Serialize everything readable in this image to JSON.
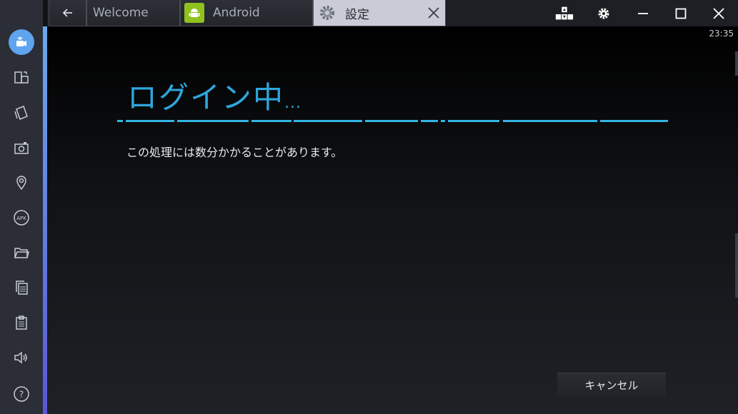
{
  "tabs": {
    "welcome": "Welcome",
    "android": "Android",
    "settings": "設定"
  },
  "status": {
    "clock": "23:35"
  },
  "dialog": {
    "title": "ログイン中",
    "title_suffix": "...",
    "message": "この処理には数分かかることがあります。",
    "cancel_label": "キャンセル"
  },
  "sidebar": {
    "apk_label": "APK",
    "help_label": "?"
  },
  "colors": {
    "accent": "#2ea6dc",
    "active_sidebar": "#5ea4ee",
    "android_green": "#8fc21f"
  },
  "icons": {
    "sidebar": [
      "video-call-icon",
      "phone-rotate-icon",
      "shake-icon",
      "screenshot-icon",
      "location-icon",
      "apk-icon",
      "folder-icon",
      "copy-icon",
      "paste-icon",
      "volume-icon",
      "help-icon"
    ],
    "titlebar": [
      "back-arrow-icon",
      "android-icon",
      "gear-icon",
      "close-icon",
      "keyboard-icon",
      "settings-gear-icon",
      "minimize-icon",
      "maximize-icon",
      "window-close-icon"
    ]
  }
}
